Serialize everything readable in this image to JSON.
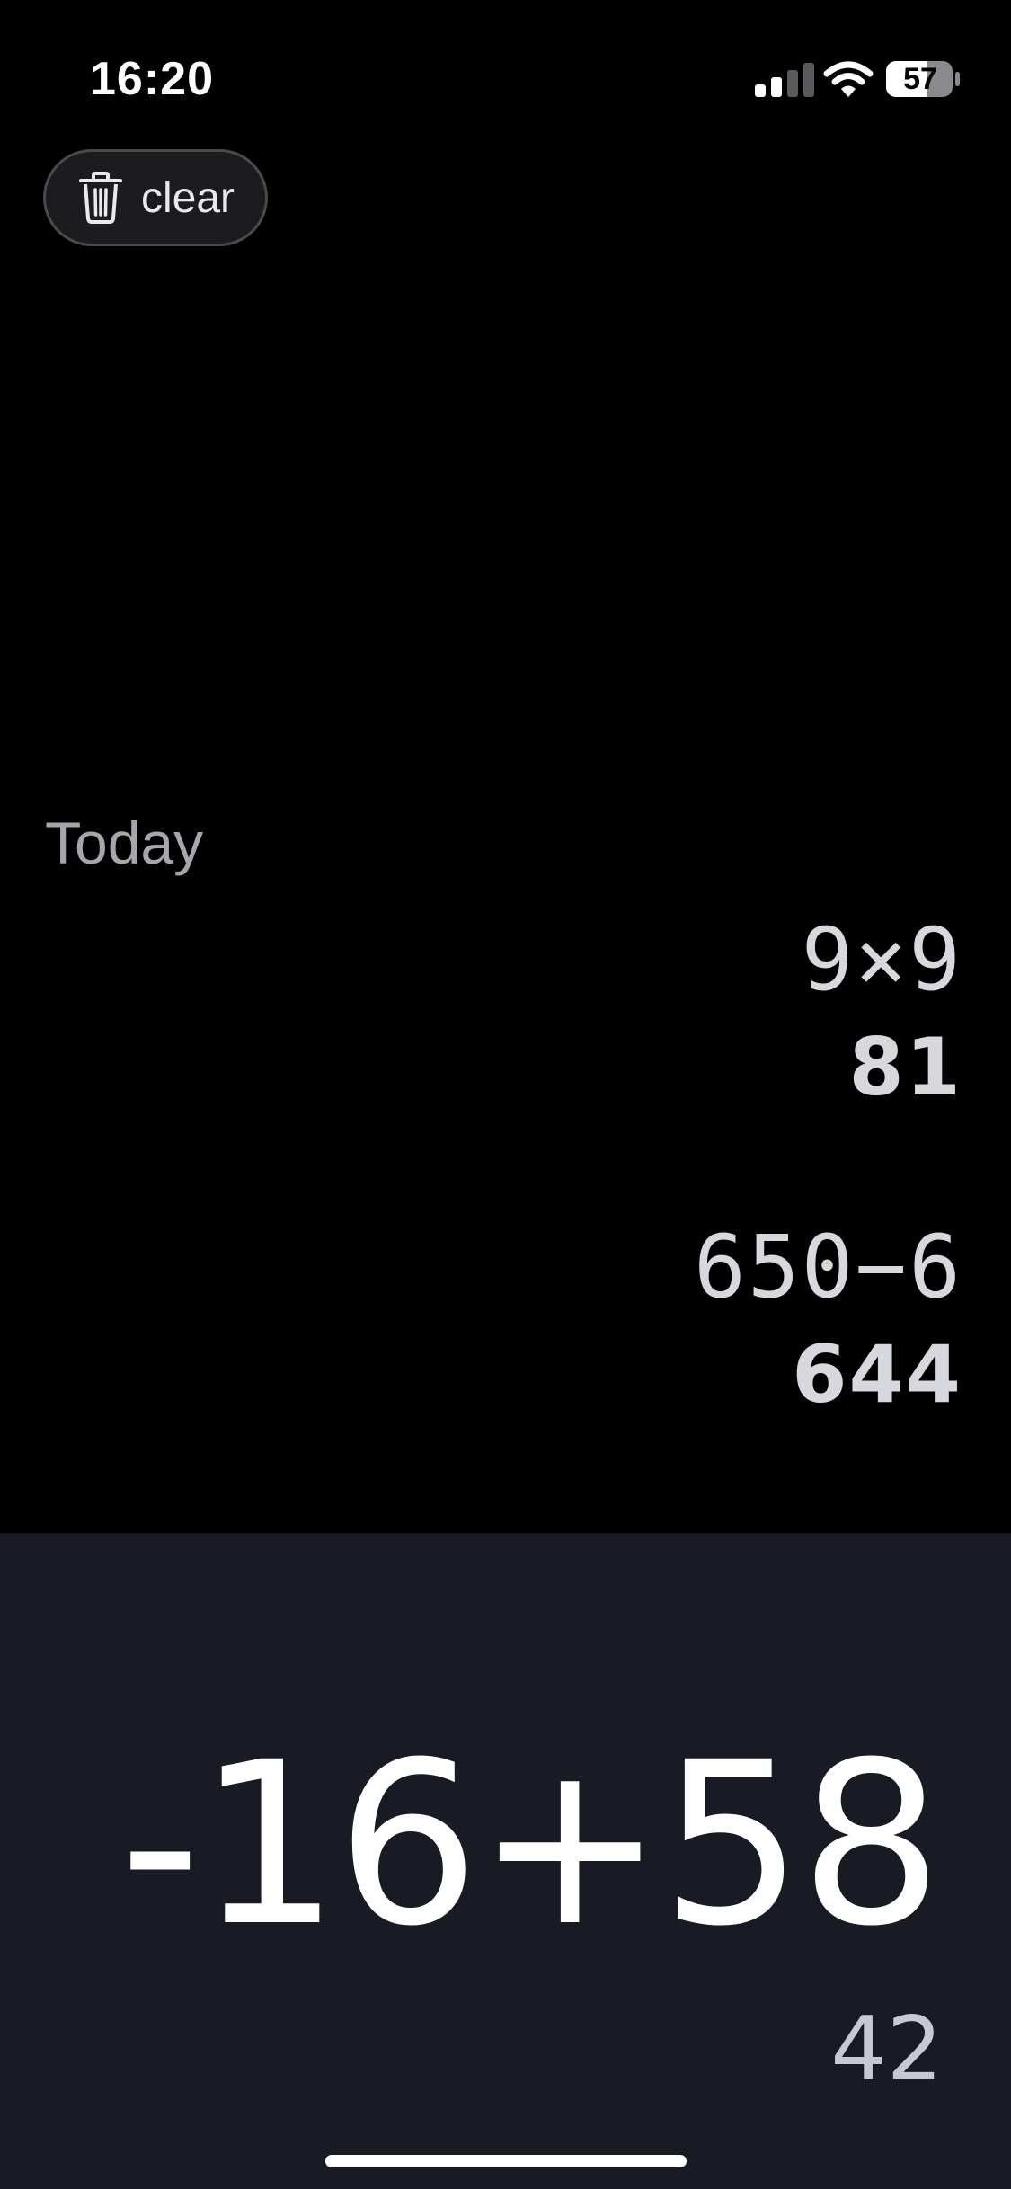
{
  "status_bar": {
    "time": "16:20",
    "battery": "57"
  },
  "toolbar": {
    "clear_label": "clear"
  },
  "history": {
    "section_label": "Today",
    "entries": [
      {
        "expression": "9×9",
        "result": "81"
      },
      {
        "expression": "650−6",
        "result": "644"
      }
    ]
  },
  "input": {
    "expression": "-16+58",
    "result": "42"
  },
  "colors": {
    "background": "#000000",
    "input_panel": "#181b24",
    "button_background": "#1c1c1e",
    "muted_text": "#a6a6ad"
  }
}
